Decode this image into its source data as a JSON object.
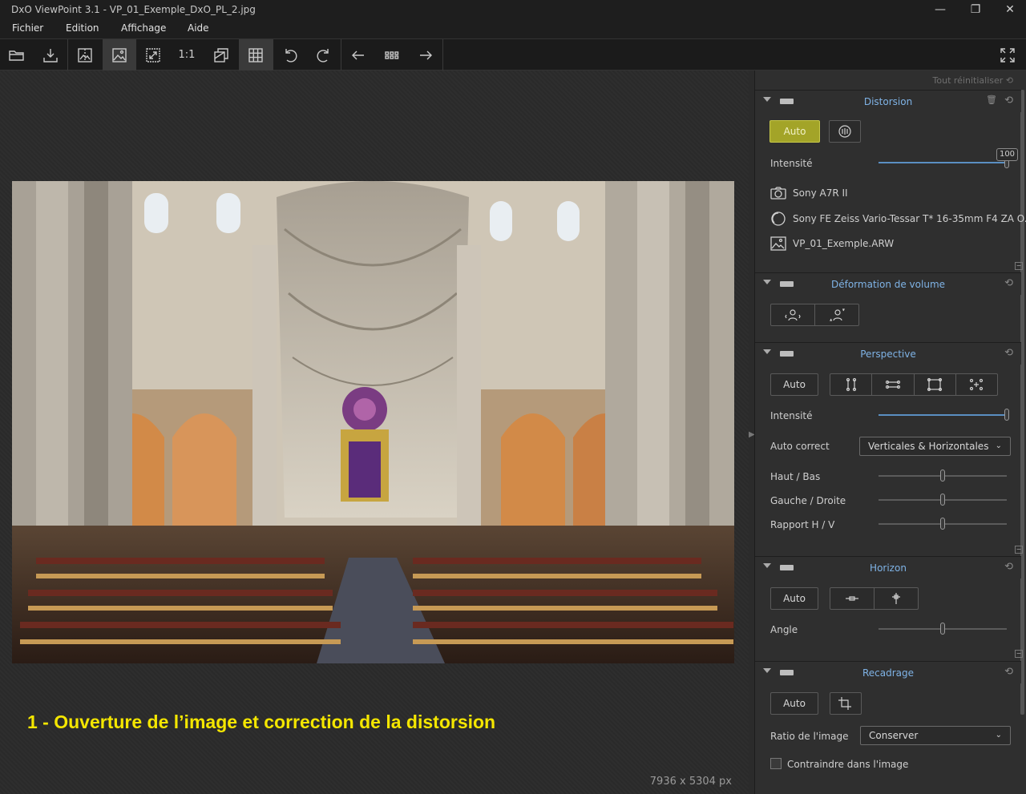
{
  "window": {
    "title": "DxO ViewPoint 3.1 - VP_01_Exemple_DxO_PL_2.jpg",
    "minimize": "—",
    "restore": "❐",
    "close": "✕"
  },
  "menu": [
    "Fichier",
    "Edition",
    "Affichage",
    "Aide"
  ],
  "toolbar": {
    "icons": [
      "open-folder-icon",
      "export-icon",
      "compare-icon",
      "image-view-icon",
      "fit-screen-icon",
      "one-to-one-icon",
      "before-after-icon",
      "grid-icon",
      "rotate-left-icon",
      "rotate-right-icon",
      "previous-icon",
      "filmstrip-icon",
      "next-icon",
      "fullscreen-icon"
    ],
    "one_to_one_label": "1:1"
  },
  "canvas": {
    "caption": "1 - Ouverture de l’image et correction de la distorsion",
    "dimensions": "7936 x 5304 px"
  },
  "panel": {
    "reset_all": "Tout réinitialiser",
    "distorsion": {
      "title": "Distorsion",
      "auto_label": "Auto",
      "intensity_label": "Intensité",
      "intensity_value": "100",
      "camera": "Sony A7R II",
      "lens": "Sony FE Zeiss Vario-Tessar T* 16-35mm F4 ZA O...",
      "file": "VP_01_Exemple.ARW"
    },
    "volume": {
      "title": "Déformation de volume"
    },
    "perspective": {
      "title": "Perspective",
      "auto_label": "Auto",
      "intensity_label": "Intensité",
      "auto_correct_label": "Auto correct",
      "auto_correct_value": "Verticales & Horizontales",
      "haut_bas": "Haut / Bas",
      "gauche_droite": "Gauche / Droite",
      "rapport": "Rapport H / V"
    },
    "horizon": {
      "title": "Horizon",
      "auto_label": "Auto",
      "angle_label": "Angle"
    },
    "recadrage": {
      "title": "Recadrage",
      "auto_label": "Auto",
      "ratio_label": "Ratio de l'image",
      "ratio_value": "Conserver",
      "constrain_label": "Contraindre dans l'image"
    }
  }
}
